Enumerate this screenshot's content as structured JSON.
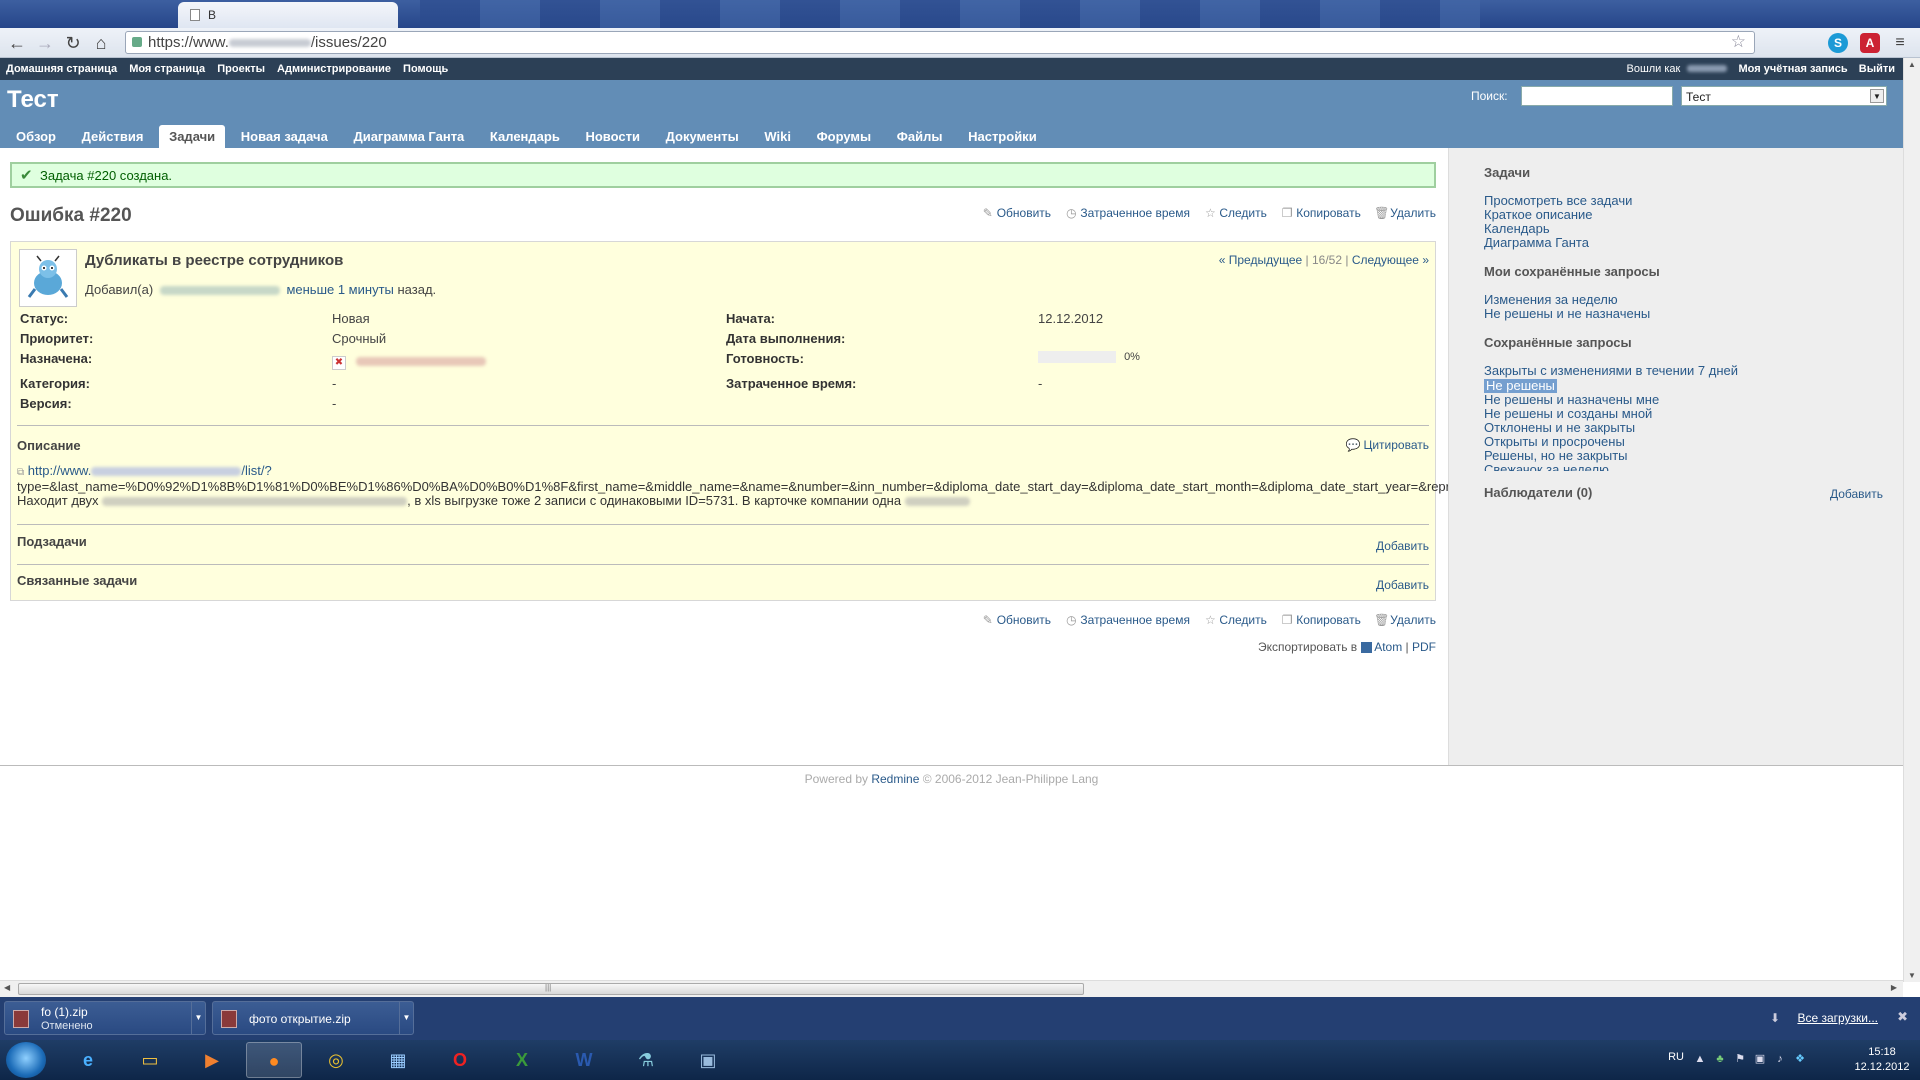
{
  "browser": {
    "tab_title": "В",
    "url_scheme": "https://www.",
    "url_path": "/issues/220"
  },
  "top_menu": {
    "items": [
      "Домашняя страница",
      "Моя страница",
      "Проекты",
      "Администрирование",
      "Помощь"
    ],
    "logged_as": "Вошли как",
    "my_account": "Моя учётная запись",
    "logout": "Выйти"
  },
  "header": {
    "project_title": "Тест",
    "search_label": "Поиск:",
    "search_value": "",
    "project_select": "Тест"
  },
  "main_menu": {
    "items": [
      "Обзор",
      "Действия",
      "Задачи",
      "Новая задача",
      "Диаграмма Ганта",
      "Календарь",
      "Новости",
      "Документы",
      "Wiki",
      "Форумы",
      "Файлы",
      "Настройки"
    ],
    "selected_index": 2
  },
  "flash": {
    "prefix": "Задача",
    "link": "#220",
    "suffix": "создана."
  },
  "actions": {
    "update": "Обновить",
    "time": "Затраченное время",
    "watch": "Следить",
    "copy": "Копировать",
    "delete": "Удалить"
  },
  "issue": {
    "title": "Ошибка #220",
    "subject": "Дубликаты в реестре сотрудников",
    "added_by": "Добавил(а)",
    "added_when": "меньше 1 минуты",
    "added_suffix": "назад.",
    "prev": "« Предыдущее",
    "position": "16/52",
    "next": "Следующее »",
    "attributes": {
      "status_label": "Статус:",
      "status": "Новая",
      "priority_label": "Приоритет:",
      "priority": "Срочный",
      "assigned_label": "Назначена:",
      "category_label": "Категория:",
      "category": "-",
      "version_label": "Версия:",
      "version": "-",
      "start_label": "Начата:",
      "start": "12.12.2012",
      "due_label": "Дата выполнения:",
      "due": "",
      "done_label": "Готовность:",
      "done": "0%",
      "done_ratio": 0,
      "spent_label": "Затраченное время:",
      "spent": "-"
    },
    "description_label": "Описание",
    "quote": "Цитировать",
    "desc_line1": "http://www.",
    "desc_line1_tail": "/list/?",
    "desc_line2": "type=&last_name=%D0%92%D1%8B%D1%81%D0%BE%D1%86%D0%BA%D0%B0%D1%8F&first_name=&middle_name=&name=&number=&inn_number=&diploma_date_start_day=&diploma_date_start_month=&diploma_date_start_year=&representative_id=&diploma_date_end_day=&diploma",
    "desc_line3_a": "Находит двух",
    "desc_line3_b": ", в xls выгрузке тоже 2 записи с одинаковыми ID=5731. В карточке компании одна",
    "subtasks": "Подзадачи",
    "related": "Связанные задачи",
    "add": "Добавить"
  },
  "export": {
    "label": "Экспортировать в",
    "atom": "Atom",
    "pdf": "PDF"
  },
  "sidebar": {
    "issues_heading": "Задачи",
    "issues_links": [
      "Просмотреть все задачи",
      "Краткое описание",
      "Календарь",
      "Диаграмма Ганта"
    ],
    "my_queries_heading": "Мои сохранённые запросы",
    "my_queries": [
      "Изменения за неделю",
      "Не решены и не назначены"
    ],
    "queries_heading": "Сохранённые запросы",
    "queries": [
      "Закрыты с изменениями в течении 7 дней",
      "Не решены",
      "Не решены и назначены мне",
      "Не решены и созданы мной",
      "Отклонены и не закрыты",
      "Открыты и просрочены",
      "Решены, но не закрыты",
      "Свежачок за неделю"
    ],
    "watchers": "Наблюдатели (0)",
    "watchers_add": "Добавить"
  },
  "footer": {
    "powered": "Powered by",
    "redmine": "Redmine",
    "copy": "© 2006-2012 Jean-Philippe Lang"
  },
  "downloads": {
    "items": [
      {
        "name": "fo (1).zip",
        "status": "Отменено"
      },
      {
        "name": "фото открытие.zip",
        "status": ""
      }
    ],
    "all": "Все загрузки..."
  },
  "taskbar": {
    "lang": "RU",
    "time": "15:18",
    "date": "12.12.2012"
  }
}
